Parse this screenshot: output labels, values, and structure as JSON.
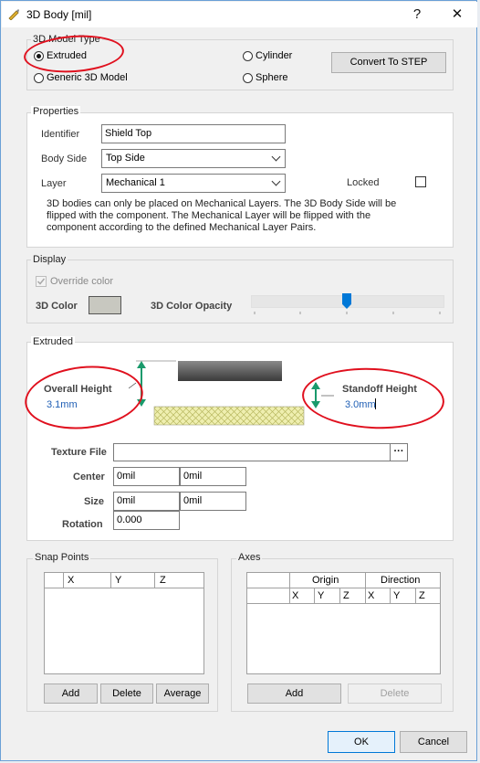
{
  "dialog": {
    "title": "3D Body [mil]",
    "help_label": "?",
    "close_label": "✕"
  },
  "model_type": {
    "group_label": "3D Model Type",
    "options": [
      "Extruded",
      "Generic 3D Model",
      "Cylinder",
      "Sphere"
    ],
    "selected": "Extruded",
    "convert_label": "Convert To STEP"
  },
  "properties": {
    "group_label": "Properties",
    "identifier_label": "Identifier",
    "identifier_value": "Shield Top",
    "body_side_label": "Body Side",
    "body_side_value": "Top Side",
    "layer_label": "Layer",
    "layer_value": "Mechanical 1",
    "locked_label": "Locked",
    "locked": false,
    "note": "3D bodies can only be placed on Mechanical Layers. The 3D Body Side will be flipped with the component. The Mechanical Layer will be flipped with the component according to the defined Mechanical Layer Pairs."
  },
  "display": {
    "group_label": "Display",
    "override_label": "Override color",
    "override_checked": true,
    "color_label": "3D Color",
    "color_value": "#c8c8c0",
    "opacity_label": "3D Color Opacity",
    "opacity_fraction": 0.5
  },
  "extruded": {
    "group_label": "Extruded",
    "overall_height_label": "Overall Height",
    "overall_height_value": "3.1mm",
    "standoff_height_label": "Standoff Height",
    "standoff_height_value": "3.0mm",
    "texture_label": "Texture File",
    "texture_value": "",
    "browse_label": "···",
    "center_label": "Center",
    "center_x": "0mil",
    "center_y": "0mil",
    "size_label": "Size",
    "size_x": "0mil",
    "size_y": "0mil",
    "rotation_label": "Rotation",
    "rotation_value": "0.000"
  },
  "snap_points": {
    "group_label": "Snap Points",
    "columns": [
      "X",
      "Y",
      "Z"
    ],
    "add_label": "Add",
    "delete_label": "Delete",
    "average_label": "Average"
  },
  "axes": {
    "group_label": "Axes",
    "origin_label": "Origin",
    "direction_label": "Direction",
    "columns": [
      "X",
      "Y",
      "Z",
      "X",
      "Y",
      "Z"
    ],
    "add_label": "Add",
    "delete_label": "Delete"
  },
  "footer": {
    "ok_label": "OK",
    "cancel_label": "Cancel"
  },
  "colors": {
    "annotation": "#e0101e",
    "accent": "#0078d7",
    "arrow": "#1a9a6c"
  }
}
